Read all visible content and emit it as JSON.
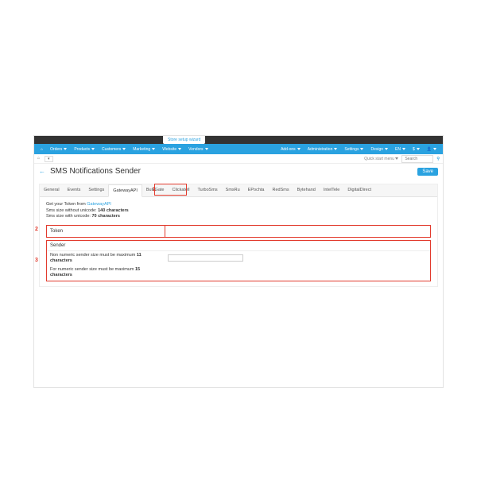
{
  "wizard": "Store setup wizard",
  "menu": {
    "left": [
      "Orders",
      "Products",
      "Customers",
      "Marketing",
      "Website",
      "Vendors"
    ],
    "right": [
      "Add-ons",
      "Administration",
      "Settings",
      "Design",
      "EN",
      "$"
    ]
  },
  "subbar": {
    "quick": "Quick start menu",
    "search_placeholder": "Search"
  },
  "title": "SMS Notifications Sender",
  "save": "Save",
  "tabs": [
    "General",
    "Events",
    "Settings",
    "GatewayAPI",
    "BulkGate",
    "Clickatell",
    "TurboSms",
    "SmsRu",
    "EPochta",
    "RedSms",
    "Bytehand",
    "IntelTele",
    "DigitalDirect"
  ],
  "active_tab": 3,
  "info": {
    "l1a": "Get your Token from ",
    "l1b": "GatewayAPI",
    "l2a": "Sms size without unicode: ",
    "l2b": "140 characters",
    "l3a": "Sms size with unicode: ",
    "l3b": "70 characters"
  },
  "token_label": "Token",
  "sender_label": "Sender",
  "hint1a": "Non numeric sender size must be maximum ",
  "hint1b": "11 characters",
  "hint2a": "For numeric sender size must be maximum ",
  "hint2b": "15 characters",
  "callouts": {
    "n1": "1",
    "n2": "2",
    "n3": "3"
  }
}
